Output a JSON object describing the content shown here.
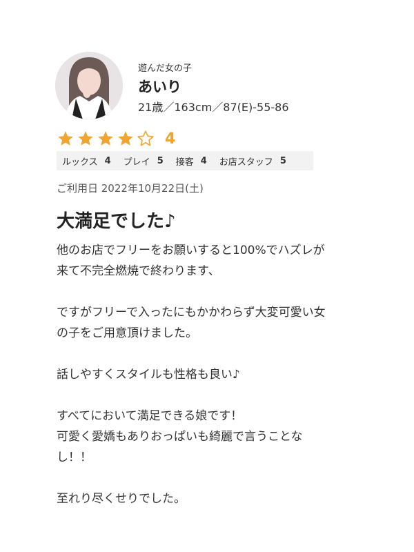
{
  "girl": {
    "label": "遊んだ女の子",
    "name": "あいり",
    "profile": "21歳／163cm／87(E)-55-86"
  },
  "rating": {
    "stars": 4,
    "max": 5,
    "value": "4",
    "star_color": "#f0a531"
  },
  "scores": [
    {
      "label": "ルックス",
      "value": "4"
    },
    {
      "label": "プレイ",
      "value": "5"
    },
    {
      "label": "接客",
      "value": "4"
    },
    {
      "label": "お店スタッフ",
      "value": "5"
    }
  ],
  "review": {
    "date": "ご利用日 2022年10月22日(土)",
    "title": "大満足でした♪",
    "lines": [
      "他のお店でフリーをお願いすると100%でハズレが",
      "来て不完全燃焼で終わります、",
      "",
      "ですがフリーで入ったにもかかわらず大変可愛い女",
      "の子をご用意頂けました。",
      "",
      "話しやすくスタイルも性格も良い♪",
      "",
      "すべてにおいて満足できる娘です！",
      "可愛く愛嬌もありおっぱいも綺麗で言うことな",
      "し！！",
      "",
      "至れり尽くせりでした。"
    ]
  }
}
